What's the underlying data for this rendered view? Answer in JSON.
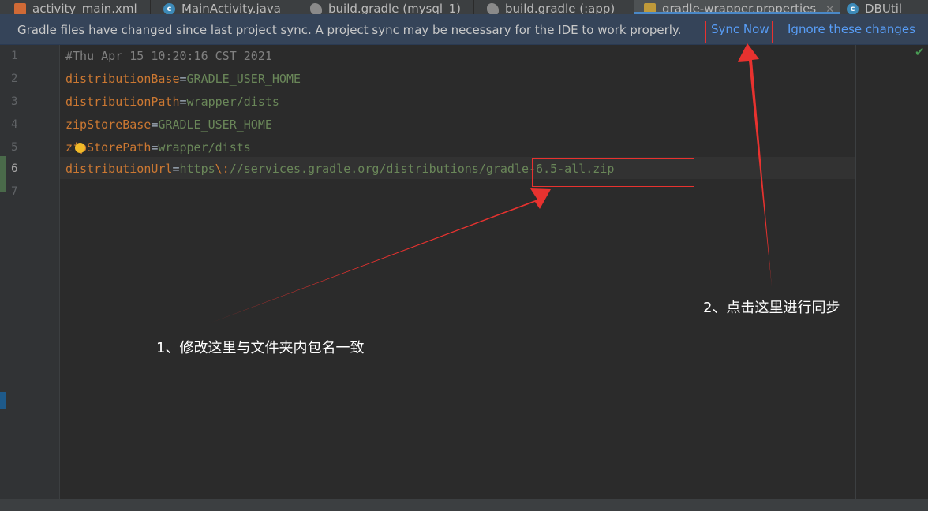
{
  "tabs": [
    {
      "label": "activity_main.xml",
      "icon": "xml-file-icon",
      "active": false
    },
    {
      "label": "MainActivity.java",
      "icon": "java-class-icon",
      "active": false
    },
    {
      "label": "build.gradle (mysql_1)",
      "icon": "gradle-elephant-icon",
      "active": false
    },
    {
      "label": "build.gradle (:app)",
      "icon": "gradle-elephant-icon",
      "active": false
    },
    {
      "label": "gradle-wrapper.properties",
      "icon": "properties-file-icon",
      "active": true
    },
    {
      "label": "DBUtil",
      "icon": "java-class-icon",
      "active": false
    }
  ],
  "banner": {
    "message": "Gradle files have changed since last project sync. A project sync may be necessary for the IDE to work properly.",
    "sync_now": "Sync Now",
    "ignore": "Ignore these changes"
  },
  "editor": {
    "line_numbers": [
      "1",
      "2",
      "3",
      "4",
      "5",
      "6",
      "7"
    ],
    "current_line": 6,
    "lines": [
      {
        "comment": "#Thu Apr 15 10:20:16 CST 2021"
      },
      {
        "key": "distributionBase",
        "sep": "=",
        "value": "GRADLE_USER_HOME"
      },
      {
        "key": "distributionPath",
        "sep": "=",
        "value": "wrapper/dists"
      },
      {
        "key": "zipStoreBase",
        "sep": "=",
        "value": "GRADLE_USER_HOME"
      },
      {
        "key": "zipStorePath",
        "sep": "=",
        "value": "wrapper/dists"
      },
      {
        "key": "distributionUrl",
        "sep": "=",
        "value_a": "https",
        "escape": "\\:",
        "value_b": "//services.gradle.org/distributions/gradle-6.5-all.zip"
      }
    ],
    "status_icon": "check-icon"
  },
  "annotations": {
    "note1": "1、修改这里与文件夹内包名一致",
    "note2": "2、点击这里进行同步",
    "color": "#e8322f"
  },
  "colors": {
    "keyword": "#cc7832",
    "string": "#6a8759",
    "comment": "#808080",
    "link": "#589df6",
    "banner_bg": "#354459"
  }
}
